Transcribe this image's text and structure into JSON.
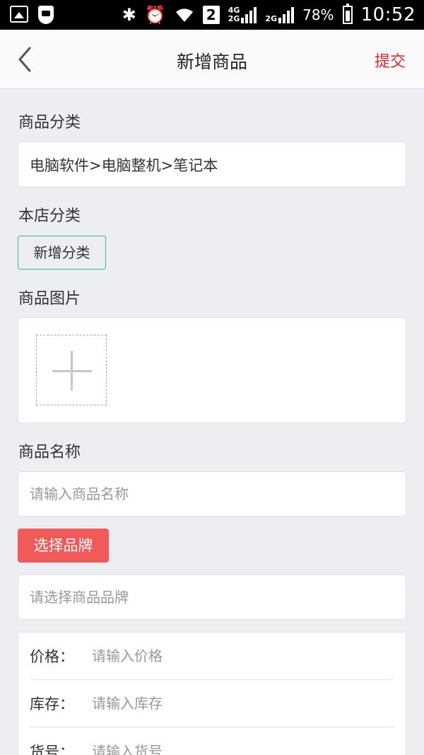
{
  "status_bar": {
    "sim_badge": "2",
    "network_top": "4G",
    "network_bottom": "2G",
    "network_second": "2G",
    "battery": "78%",
    "time": "10:52"
  },
  "header": {
    "title": "新增商品",
    "submit_label": "提交"
  },
  "category": {
    "label": "商品分类",
    "value": "电脑软件>电脑整机>笔记本"
  },
  "shop_category": {
    "label": "本店分类",
    "add_button": "新增分类"
  },
  "images": {
    "label": "商品图片"
  },
  "name": {
    "label": "商品名称",
    "placeholder": "请输入商品名称"
  },
  "brand": {
    "button": "选择品牌",
    "placeholder": "请选择商品品牌"
  },
  "form": {
    "price_label": "价格：",
    "price_placeholder": "请输入价格",
    "stock_label": "库存：",
    "stock_placeholder": "请输入库存",
    "sku_label": "货号：",
    "sku_placeholder": "请输入货号"
  },
  "colors": {
    "accent_red": "#e8252a",
    "brand_button": "#f25a5a",
    "tag_border": "#3cb59a"
  }
}
